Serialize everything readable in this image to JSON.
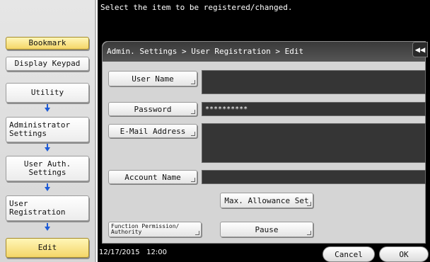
{
  "left_nav": {
    "bookmark": "Bookmark",
    "display_keypad": "Display Keypad",
    "utility": "Utility",
    "administrator_settings": "Administrator\nSettings",
    "user_auth_settings": "User Auth.\nSettings",
    "user_registration": "User\nRegistration",
    "edit": "Edit"
  },
  "header": {
    "message": "Select the item to be registered/changed.",
    "breadcrumb": "Admin. Settings > User Registration > Edit",
    "back_glyph": "◀◀"
  },
  "form": {
    "user_name_label": "User Name",
    "user_name_value": "",
    "password_label": "Password",
    "password_value": "**********",
    "email_label": "E-Mail Address",
    "email_value": "",
    "account_name_label": "Account Name",
    "account_name_value": "",
    "max_allowance_label": "Max. Allowance Set",
    "function_permission_label": "Function Permission/\nAuthority",
    "pause_label": "Pause"
  },
  "footer": {
    "datetime": "12/17/2015   12:00",
    "cancel_label": "Cancel",
    "ok_label": "OK"
  },
  "colors": {
    "accent_yellow": "#f4d668",
    "arrow_blue": "#1e5bd6",
    "field_dark": "#353535"
  }
}
